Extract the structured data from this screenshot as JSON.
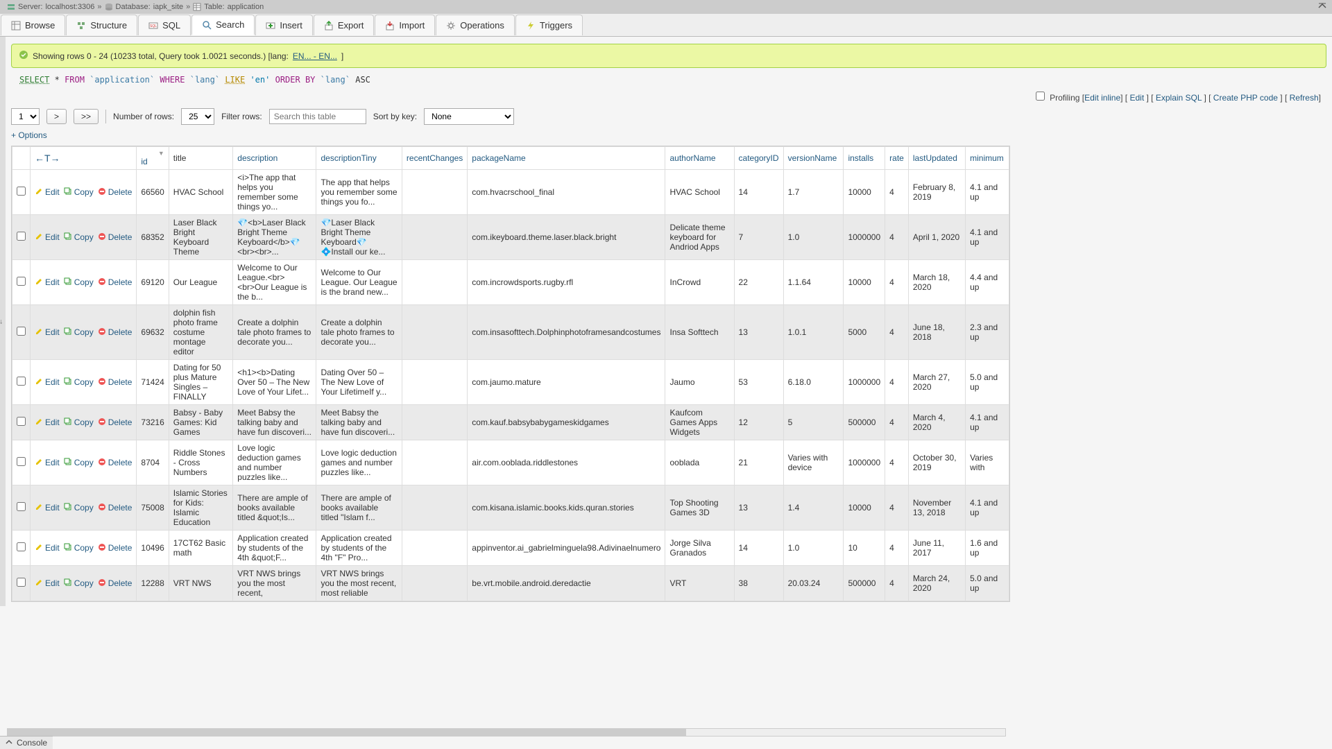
{
  "breadcrumb": {
    "server_label": "Server:",
    "server_value": "localhost:3306",
    "db_label": "Database:",
    "db_value": "iapk_site",
    "table_label": "Table:",
    "table_value": "application",
    "sep": "»"
  },
  "tabs": [
    {
      "key": "browse",
      "label": "Browse"
    },
    {
      "key": "structure",
      "label": "Structure"
    },
    {
      "key": "sql",
      "label": "SQL"
    },
    {
      "key": "search",
      "label": "Search"
    },
    {
      "key": "insert",
      "label": "Insert"
    },
    {
      "key": "export",
      "label": "Export"
    },
    {
      "key": "import",
      "label": "Import"
    },
    {
      "key": "operations",
      "label": "Operations"
    },
    {
      "key": "triggers",
      "label": "Triggers"
    }
  ],
  "active_tab": "search",
  "success": {
    "prefix": "Showing rows 0 - 24 (10233 total, Query took 1.0021 seconds.) [lang:",
    "lang_link": "EN... - EN...",
    "suffix": "]"
  },
  "sql": {
    "select": "SELECT",
    "star": "*",
    "from": "FROM",
    "tbl": "`application`",
    "where": "WHERE",
    "col1": "`lang`",
    "like": "LIKE",
    "val": "'en'",
    "order": "ORDER BY",
    "col2": "`lang`",
    "dir": "ASC"
  },
  "tools": {
    "profiling": "Profiling",
    "edit_inline": "Edit inline",
    "edit": "Edit",
    "explain": "Explain SQL",
    "create_php": "Create PHP code",
    "refresh": "Refresh"
  },
  "controls": {
    "page_value": "1",
    "next": ">",
    "last": ">>",
    "numrows_label": "Number of rows:",
    "numrows_value": "25",
    "filter_label": "Filter rows:",
    "filter_placeholder": "Search this table",
    "sortkey_label": "Sort by key:",
    "sortkey_value": "None"
  },
  "options_link": "+ Options",
  "columns": [
    "id",
    "title",
    "description",
    "descriptionTiny",
    "recentChanges",
    "packageName",
    "authorName",
    "categoryID",
    "versionName",
    "installs",
    "rate",
    "lastUpdated",
    "minimum"
  ],
  "action_labels": {
    "edit": "Edit",
    "copy": "Copy",
    "delete": "Delete"
  },
  "rows": [
    {
      "id": "66560",
      "title": "HVAC School",
      "description": "<i>The app that helps you remember some things yo...",
      "descriptionTiny": "The app that helps you remember some things you fo...",
      "recentChanges": "",
      "packageName": "com.hvacrschool_final",
      "authorName": "HVAC School",
      "categoryID": "14",
      "versionName": "1.7",
      "installs": "10000",
      "rate": "4",
      "lastUpdated": "February 8, 2019",
      "minimum": "4.1 and up"
    },
    {
      "id": "68352",
      "title": "Laser Black Bright Keyboard Theme",
      "description": "💎<b>Laser Black Bright Theme Keyboard</b>💎<br><br>...",
      "descriptionTiny": "💎Laser Black Bright Theme Keyboard💎 💠Install our ke...",
      "recentChanges": "",
      "packageName": "com.ikeyboard.theme.laser.black.bright",
      "authorName": "Delicate theme keyboard for Andriod Apps",
      "categoryID": "7",
      "versionName": "1.0",
      "installs": "1000000",
      "rate": "4",
      "lastUpdated": "April 1, 2020",
      "minimum": "4.1 and up"
    },
    {
      "id": "69120",
      "title": "Our League",
      "description": "Welcome to Our League.<br><br>Our League is the b...",
      "descriptionTiny": "Welcome to Our League. Our League is the brand new...",
      "recentChanges": "",
      "packageName": "com.incrowdsports.rugby.rfl",
      "authorName": "InCrowd",
      "categoryID": "22",
      "versionName": "1.1.64",
      "installs": "10000",
      "rate": "4",
      "lastUpdated": "March 18, 2020",
      "minimum": "4.4 and up"
    },
    {
      "id": "69632",
      "title": "dolphin fish photo frame costume montage editor",
      "description": "Create a dolphin tale photo frames to decorate you...",
      "descriptionTiny": "Create a dolphin tale photo frames to decorate you...",
      "recentChanges": "",
      "packageName": "com.insasofttech.Dolphinphotoframesandcostumes",
      "authorName": "Insa Softtech",
      "categoryID": "13",
      "versionName": "1.0.1",
      "installs": "5000",
      "rate": "4",
      "lastUpdated": "June 18, 2018",
      "minimum": "2.3 and up"
    },
    {
      "id": "71424",
      "title": "Dating for 50 plus Mature Singles – FINALLY",
      "description": "<h1><b>Dating Over 50 – The New Love of Your Lifet...",
      "descriptionTiny": "Dating Over 50 – The New Love of Your LifetimeIf y...",
      "recentChanges": "",
      "packageName": "com.jaumo.mature",
      "authorName": "Jaumo",
      "categoryID": "53",
      "versionName": "6.18.0",
      "installs": "1000000",
      "rate": "4",
      "lastUpdated": "March 27, 2020",
      "minimum": "5.0 and up"
    },
    {
      "id": "73216",
      "title": "Babsy - Baby Games: Kid Games",
      "description": "Meet Babsy the talking baby and have fun discoveri...",
      "descriptionTiny": "Meet Babsy the talking baby and have fun discoveri...",
      "recentChanges": "",
      "packageName": "com.kauf.babsybabygameskidgames",
      "authorName": "Kaufcom Games Apps Widgets",
      "categoryID": "12",
      "versionName": "5",
      "installs": "500000",
      "rate": "4",
      "lastUpdated": "March 4, 2020",
      "minimum": "4.1 and up"
    },
    {
      "id": "8704",
      "title": "Riddle Stones - Cross Numbers",
      "description": "Love logic deduction games and number puzzles like...",
      "descriptionTiny": "Love logic deduction games and number puzzles like...",
      "recentChanges": "",
      "packageName": "air.com.ooblada.riddlestones",
      "authorName": "ooblada",
      "categoryID": "21",
      "versionName": "Varies with device",
      "installs": "1000000",
      "rate": "4",
      "lastUpdated": "October 30, 2019",
      "minimum": "Varies with"
    },
    {
      "id": "75008",
      "title": "Islamic Stories for Kids: Islamic Education",
      "description": "There are ample of books available titled &quot;Is...",
      "descriptionTiny": "There are ample of books available titled \"Islam f...",
      "recentChanges": "",
      "packageName": "com.kisana.islamic.books.kids.quran.stories",
      "authorName": "Top Shooting Games 3D",
      "categoryID": "13",
      "versionName": "1.4",
      "installs": "10000",
      "rate": "4",
      "lastUpdated": "November 13, 2018",
      "minimum": "4.1 and up"
    },
    {
      "id": "10496",
      "title": "17CT62  Basic math",
      "description": "Application created by students of the 4th &quot;F...",
      "descriptionTiny": "Application created by students of the 4th \"F\" Pro...",
      "recentChanges": "",
      "packageName": "appinventor.ai_gabrielminguela98.Adivinaelnumero",
      "authorName": "Jorge Silva Granados",
      "categoryID": "14",
      "versionName": "1.0",
      "installs": "10",
      "rate": "4",
      "lastUpdated": "June 11, 2017",
      "minimum": "1.6 and up"
    },
    {
      "id": "12288",
      "title": "VRT NWS",
      "description": "VRT NWS brings you the most recent,",
      "descriptionTiny": "VRT NWS brings you the most recent, most reliable",
      "recentChanges": "",
      "packageName": "be.vrt.mobile.android.deredactie",
      "authorName": "VRT",
      "categoryID": "38",
      "versionName": "20.03.24",
      "installs": "500000",
      "rate": "4",
      "lastUpdated": "March 24, 2020",
      "minimum": "5.0 and up"
    }
  ],
  "console_label": "Console"
}
